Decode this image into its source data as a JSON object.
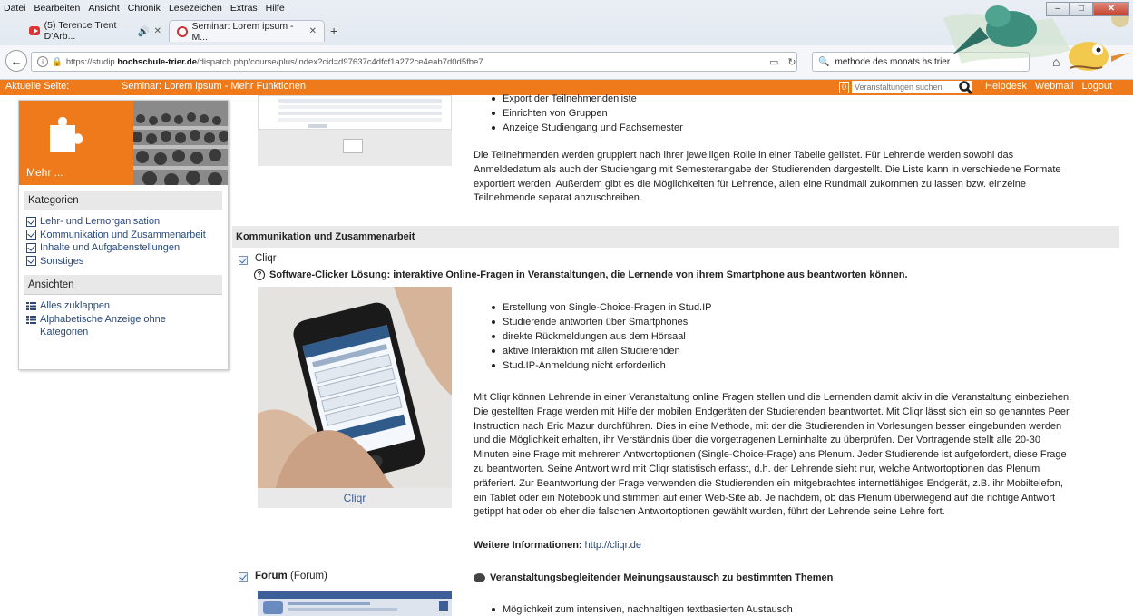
{
  "browser": {
    "menu": [
      "Datei",
      "Bearbeiten",
      "Ansicht",
      "Chronik",
      "Lesezeichen",
      "Extras",
      "Hilfe"
    ],
    "tabs": [
      {
        "label": "(5) Terence Trent D'Arb...",
        "active": false
      },
      {
        "label": "Seminar: Lorem ipsum - M...",
        "active": true
      }
    ],
    "url_prefix": "https://studip.",
    "url_domain": "hochschule-trier.de",
    "url_rest": "/dispatch.php/course/plus/index?cid=d97637c4dfcf1a272ce4eab7d0d5fbe7",
    "search_value": "methode des monats hs trier"
  },
  "topbar": {
    "current_label": "Aktuelle Seite:",
    "breadcrumb": "Seminar: Lorem ipsum - Mehr Funktionen",
    "badge": "0",
    "search_placeholder": "Veranstaltungen suchen",
    "links": [
      "Helpdesk",
      "Webmail",
      "Logout"
    ],
    "accent": "#ee7a1b"
  },
  "sidebar": {
    "mehr": "Mehr ...",
    "categories_title": "Kategorien",
    "categories": [
      "Lehr- und Lernorganisation",
      "Kommunikation und Zusammenarbeit",
      "Inhalte und Aufgabenstellungen",
      "Sonstiges"
    ],
    "views_title": "Ansichten",
    "views": [
      "Alles zuklappen",
      "Alphabetische Anzeige ohne Kategorien"
    ]
  },
  "top_item": {
    "bullets": [
      "Export der Teilnehmendenliste",
      "Einrichten von Gruppen",
      "Anzeige Studiengang und Fachsemester"
    ],
    "lines": [
      "Die Teilnehmenden werden gruppiert nach ihrer jeweiligen Rolle in einer Tabelle gelistet. Für Lehrende werden sowohl das",
      "Anmeldedatum als auch der Studiengang mit Semesterangabe der Studierenden dargestellt. Die Liste kann in verschiedene Formate",
      "exportiert werden. Außerdem gibt es die Möglichkeiten für Lehrende, allen eine Rundmail zukommen zu lassen bzw. einzelne",
      "Teilnehmende separat anzuschreiben."
    ]
  },
  "section": {
    "title": "Kommunikation und Zusammenarbeit"
  },
  "cliqr": {
    "title": "Cliqr",
    "subtitle": "Software-Clicker Lösung: interaktive Online-Fragen in Veranstaltungen, die Lernende von ihrem Smartphone aus beantworten können.",
    "bullets": [
      "Erstellung von Single-Choice-Fragen in Stud.IP",
      "Studierende antworten über Smartphones",
      "direkte Rückmeldungen aus dem Hörsaal",
      "aktive Interaktion mit allen Studierenden",
      "Stud.IP-Anmeldung nicht erforderlich"
    ],
    "lines": [
      "Mit Cliqr können Lehrende in einer Veranstaltung online Fragen stellen und die Lernenden damit aktiv in die Veranstaltung einbeziehen.",
      "Die gestellten Frage werden mit Hilfe der mobilen Endgeräten der Studierenden beantwortet. Mit Cliqr lässt sich ein so genanntes Peer",
      "Instruction nach Eric Mazur durchführen. Dies in eine Methode, mit der die Studierenden in Vorlesungen besser eingebunden werden",
      "und die Möglichkeit erhalten, ihr Verständnis über die vorgetragenen Lerninhalte zu überprüfen. Der Vortragende stellt alle 20-30",
      "Minuten eine Frage mit mehreren Antwortoptionen (Single-Choice-Frage) ans Plenum. Jeder Studierende ist aufgefordert, diese Frage",
      "zu beantworten. Seine Antwort wird mit Cliqr statistisch erfasst, d.h. der Lehrende sieht nur, welche Antwortoptionen das Plenum",
      "präferiert. Zur Beantwortung der Frage verwenden die Studierenden ein mitgebrachtes internetfähiges Endgerät, z.B. ihr Mobiltelefon,",
      "ein Tablet oder ein Notebook und stimmen auf einer Web-Site ab. Je nachdem, ob das Plenum überwiegend auf die richtige Antwort",
      "getippt hat oder ob eher die falschen Antwortoptionen gewählt wurden, führt der Lehrende seine Lehre fort."
    ],
    "caption": "Cliqr",
    "more_label": "Weitere Informationen:",
    "more_link": "http://cliqr.de"
  },
  "forum": {
    "title": "Forum",
    "title_suffix": "(Forum)",
    "subtitle": "Veranstaltungsbegleitender Meinungsaustausch zu bestimmten Themen",
    "bullets": [
      "Möglichkeit zum intensiven, nachhaltigen textbasierten Austausch"
    ]
  }
}
